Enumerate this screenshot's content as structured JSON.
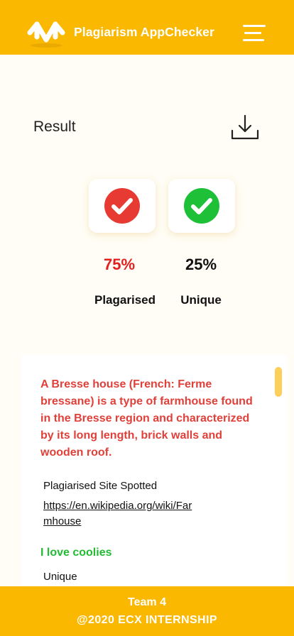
{
  "header": {
    "title": "Plagiarism AppChecker",
    "logo_icon": "app-logo-icon",
    "menu_icon": "hamburger-menu-icon"
  },
  "result": {
    "title": "Result",
    "download_icon": "download-icon",
    "plagiarised": {
      "percent": "75%",
      "label": "Plagarised",
      "icon": "red-check-circle-icon",
      "color": "#e63a33"
    },
    "unique": {
      "percent": "25%",
      "label": "Unique",
      "icon": "green-check-circle-icon",
      "color": "#1ec038"
    }
  },
  "content": {
    "plagiarised_text": "A Bresse house (French: Ferme bressane) is a type of farmhouse found in the Bresse region and characterized by its long length, brick walls and wooden roof.",
    "site_label": "Plagiarised Site Spotted",
    "site_url": "https://en.wikipedia.org/wiki/Farmhouse",
    "unique_text": "I love coolies",
    "unique_label": "Unique"
  },
  "footer": {
    "line1": "Team 4",
    "line2": "@2020 ECX INTERNSHIP"
  },
  "colors": {
    "brand": "#fbb800",
    "plagiarised": "#e0403a",
    "unique": "#22bb33"
  }
}
